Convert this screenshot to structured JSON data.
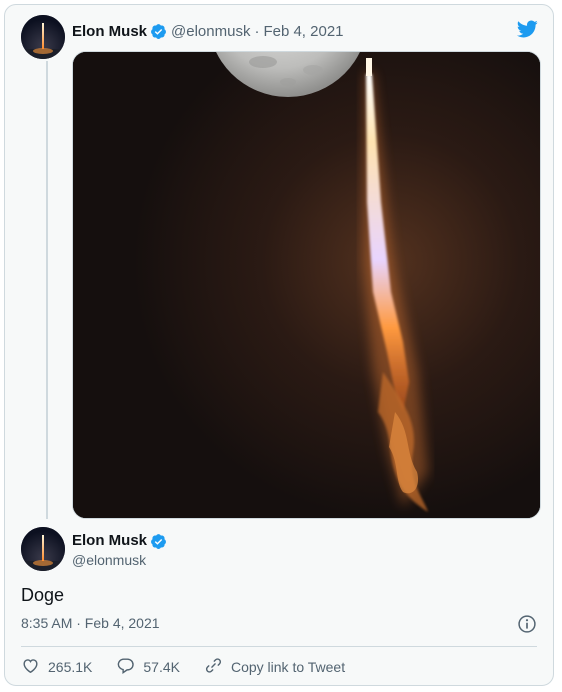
{
  "tweet": {
    "author": {
      "name": "Elon Musk",
      "handle": "@elonmusk",
      "verified": true
    },
    "header_date": "Feb 4, 2021",
    "separator": "·",
    "text": "Doge",
    "timestamp": "8:35 AM · Feb 4, 2021",
    "media": {
      "description_icon": "photo",
      "subject": "rocket-launch-with-moon"
    }
  },
  "actions": {
    "likes": "265.1K",
    "replies": "57.4K",
    "copy_link": "Copy link to Tweet"
  },
  "icons": {
    "brand": "twitter-bird-icon",
    "verified": "verified-badge-icon",
    "info": "info-icon",
    "like": "heart-icon",
    "reply": "reply-bubble-icon",
    "link": "link-icon"
  },
  "colors": {
    "twitter_blue": "#1d9bf0",
    "text": "#0f1419",
    "muted": "#536471",
    "border": "#cfd9de",
    "card_bg": "#f7f9f9"
  }
}
